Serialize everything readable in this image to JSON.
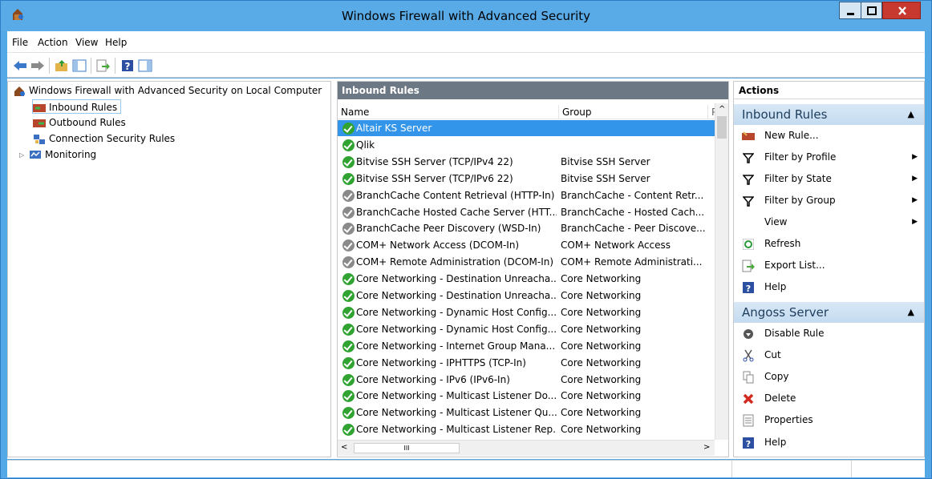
{
  "window": {
    "title": "Windows Firewall with Advanced Security"
  },
  "menu": {
    "items": [
      "File",
      "Action",
      "View",
      "Help"
    ]
  },
  "toolbar": {
    "buttons": [
      "back-arrow-icon",
      "forward-arrow-icon",
      "up-folder-icon",
      "show-hide-tree-icon",
      "export-list-icon",
      "help-icon",
      "show-hide-action-pane-icon"
    ]
  },
  "tree": {
    "root": "Windows Firewall with Advanced Security on Local Computer",
    "items": [
      "Inbound Rules",
      "Outbound Rules",
      "Connection Security Rules",
      "Monitoring"
    ]
  },
  "rules_pane": {
    "header": "Inbound Rules",
    "columns": [
      "Name",
      "Group",
      "P"
    ],
    "rows": [
      {
        "name": "Altair KS Server",
        "group": "",
        "enabled": true,
        "selected": true
      },
      {
        "name": "Qlik",
        "group": "",
        "enabled": true
      },
      {
        "name": "Bitvise SSH Server (TCP/IPv4 22)",
        "group": "Bitvise SSH Server",
        "enabled": true
      },
      {
        "name": "Bitvise SSH Server (TCP/IPv6 22)",
        "group": "Bitvise SSH Server",
        "enabled": true
      },
      {
        "name": "BranchCache Content Retrieval (HTTP-In)",
        "group": "BranchCache - Content Retr...",
        "enabled": false
      },
      {
        "name": "BranchCache Hosted Cache Server (HTT...",
        "group": "BranchCache - Hosted Cach...",
        "enabled": false
      },
      {
        "name": "BranchCache Peer Discovery (WSD-In)",
        "group": "BranchCache - Peer Discove...",
        "enabled": false
      },
      {
        "name": "COM+ Network Access (DCOM-In)",
        "group": "COM+ Network Access",
        "enabled": false
      },
      {
        "name": "COM+ Remote Administration (DCOM-In)",
        "group": "COM+ Remote Administrati...",
        "enabled": false
      },
      {
        "name": "Core Networking - Destination Unreacha...",
        "group": "Core Networking",
        "enabled": true
      },
      {
        "name": "Core Networking - Destination Unreacha...",
        "group": "Core Networking",
        "enabled": true
      },
      {
        "name": "Core Networking - Dynamic Host Config...",
        "group": "Core Networking",
        "enabled": true
      },
      {
        "name": "Core Networking - Dynamic Host Config...",
        "group": "Core Networking",
        "enabled": true
      },
      {
        "name": "Core Networking - Internet Group Mana...",
        "group": "Core Networking",
        "enabled": true
      },
      {
        "name": "Core Networking - IPHTTPS (TCP-In)",
        "group": "Core Networking",
        "enabled": true
      },
      {
        "name": "Core Networking - IPv6 (IPv6-In)",
        "group": "Core Networking",
        "enabled": true
      },
      {
        "name": "Core Networking - Multicast Listener Do...",
        "group": "Core Networking",
        "enabled": true
      },
      {
        "name": "Core Networking - Multicast Listener Qu...",
        "group": "Core Networking",
        "enabled": true
      },
      {
        "name": "Core Networking - Multicast Listener Rep...",
        "group": "Core Networking",
        "enabled": true
      }
    ]
  },
  "actions": {
    "header": "Actions",
    "section1": {
      "title": "Inbound Rules",
      "items": [
        "New Rule...",
        "Filter by Profile",
        "Filter by State",
        "Filter by Group",
        "View",
        "Refresh",
        "Export List...",
        "Help"
      ]
    },
    "section2": {
      "title": "Angoss Server",
      "items": [
        "Disable Rule",
        "Cut",
        "Copy",
        "Delete",
        "Properties",
        "Help"
      ]
    }
  },
  "scrollbar_glyphs": {
    "up": "^",
    "left": "<",
    "right": ">",
    "thumb": "III"
  }
}
